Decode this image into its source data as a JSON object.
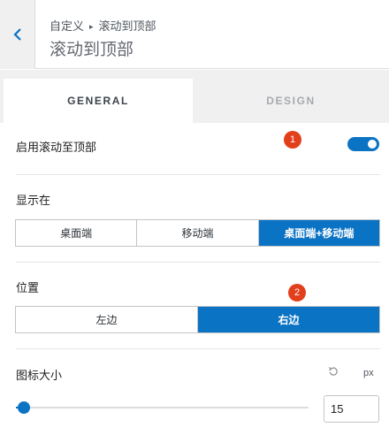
{
  "header": {
    "breadcrumb_parent": "自定义",
    "breadcrumb_separator": "▸",
    "breadcrumb_current": "滚动到顶部",
    "title": "滚动到顶部",
    "back_icon": "chevron-left-icon"
  },
  "tabs": [
    {
      "label": "GENERAL",
      "active": true
    },
    {
      "label": "DESIGN",
      "active": false
    }
  ],
  "enable": {
    "label": "启用滚动至顶部",
    "value": true,
    "badge": "1"
  },
  "display": {
    "label": "显示在",
    "options": [
      "桌面端",
      "移动端",
      "桌面端+移动端"
    ],
    "selected": "桌面端+移动端"
  },
  "position": {
    "label": "位置",
    "badge": "2",
    "options": [
      "左边",
      "右边"
    ],
    "selected": "右边"
  },
  "icon_size": {
    "label": "图标大小",
    "unit": "px",
    "value": "15",
    "reset_icon": "undo-icon"
  },
  "colors": {
    "accent": "#0b73c4",
    "badge": "#e2401c"
  }
}
